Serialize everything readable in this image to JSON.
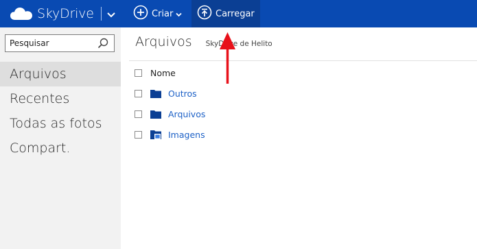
{
  "app": {
    "title": "SkyDrive"
  },
  "commands": {
    "new_label": "Criar",
    "upload_label": "Carregar"
  },
  "search": {
    "placeholder": "Pesquisar"
  },
  "nav": {
    "items": [
      {
        "label": "Arquivos",
        "selected": true
      },
      {
        "label": "Recentes",
        "selected": false
      },
      {
        "label": "Todas as fotos",
        "selected": false
      },
      {
        "label": "Compart.",
        "selected": false
      }
    ]
  },
  "main": {
    "title": "Arquivos",
    "subtitle": "SkyDrive de Helito",
    "column_name": "Nome",
    "files": [
      {
        "name": "Outros",
        "icon": "folder-icon"
      },
      {
        "name": "Arquivos",
        "icon": "folder-icon"
      },
      {
        "name": "Imagens",
        "icon": "pictures-folder-icon"
      }
    ]
  },
  "colors": {
    "topbar": "#094ab2",
    "upload_highlight": "#0b3f94",
    "link": "#1c60c6",
    "annotation": "#e8111a"
  }
}
